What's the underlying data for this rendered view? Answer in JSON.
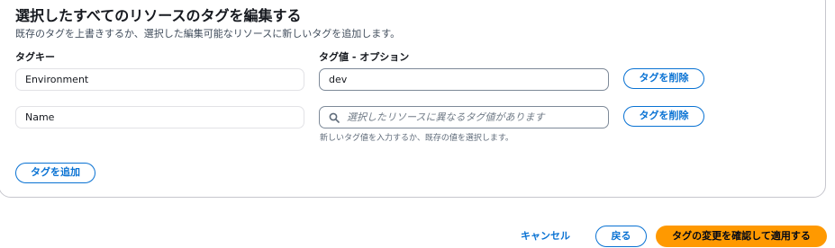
{
  "panel": {
    "title": "選択したすべてのリソースのタグを編集する",
    "subtitle": "既存のタグを上書きするか、選択した編集可能なリソースに新しいタグを追加します。"
  },
  "columns": {
    "key_label": "タグキー",
    "value_label": "タグ値 - オプション"
  },
  "rows": [
    {
      "key": "Environment",
      "value": "dev",
      "value_placeholder": "",
      "remove_label": "タグを削除"
    },
    {
      "key": "Name",
      "value": "",
      "value_placeholder": "選択したリソースに異なるタグ値があります",
      "remove_label": "タグを削除"
    }
  ],
  "value_hint": "新しいタグ値を入力するか、既存の値を選択します。",
  "add_tag_label": "タグを追加",
  "footer": {
    "cancel_label": "キャンセル",
    "back_label": "戻る",
    "confirm_label": "タグの変更を確認して適用する"
  },
  "colors": {
    "accent": "#0972d3",
    "primary": "#ff9900"
  }
}
